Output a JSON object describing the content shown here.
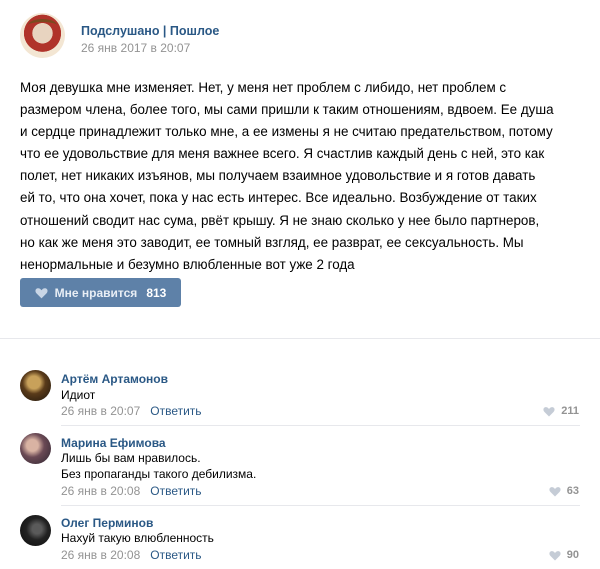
{
  "post": {
    "author": "Подслушано | Пошлое",
    "date": "26 янв 2017 в 20:07",
    "text": [
      "Моя девушка мне изменяет. Нет, у меня нет проблем с либидо, нет проблем с",
      "размером члена, более того, мы сами пришли к таким отношениям, вдвоем. Ее душа",
      "и сердце принадлежит только мне, а ее измены я не считаю предательством, потому",
      "что ее удовольствие для меня важнее всего. Я счастлив каждый день с ней, это как",
      "полет, нет никаких изъянов, мы получаем взаимное удовольствие и я готов давать",
      "ей то, что она хочет, пока у нас есть интерес. Все идеально. Возбуждение от таких",
      "отношений сводит нас сума, рвёт крышу. Я не знаю сколько у нее было партнеров,",
      "но как же меня это заводит, ее томный взгляд, ее разврат, ее сексуальность. Мы",
      "ненормальные и безумно влюбленные вот уже 2 года"
    ],
    "like_label": "Мне нравится",
    "like_count": "813"
  },
  "comments": [
    {
      "name": "Артём Артамонов",
      "text": [
        "Идиот"
      ],
      "date": "26 янв в 20:07",
      "reply": "Ответить",
      "likes": "211"
    },
    {
      "name": "Марина Ефимова",
      "text": [
        "Лишь бы вам нравилось.",
        "Без пропаганды такого дебилизма."
      ],
      "date": "26 янв в 20:08",
      "reply": "Ответить",
      "likes": "63"
    },
    {
      "name": "Олег Перминов",
      "text": [
        "Нахуй такую влюбленность"
      ],
      "date": "26 янв в 20:08",
      "reply": "Ответить",
      "likes": "90"
    }
  ],
  "icons": {
    "like": "heart-icon"
  },
  "colors": {
    "link": "#2a5885",
    "button": "#5e81a8",
    "muted": "#939393"
  }
}
